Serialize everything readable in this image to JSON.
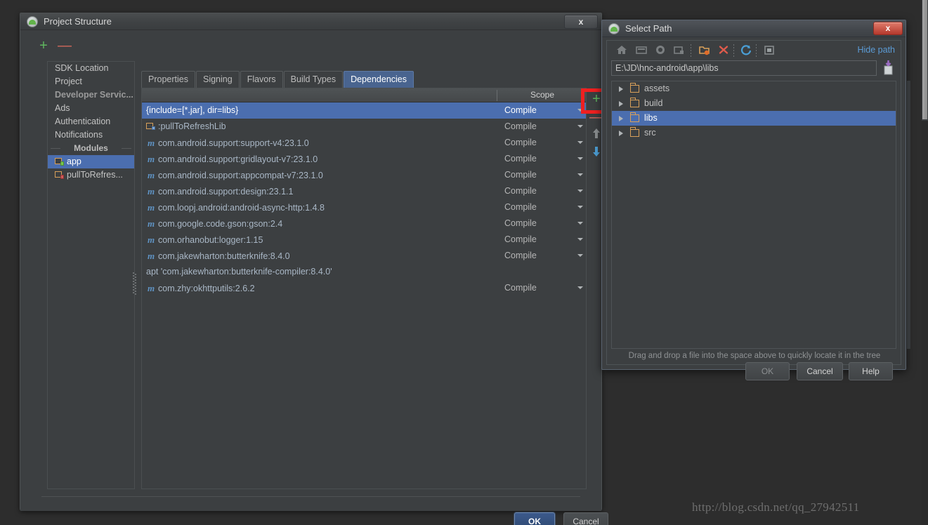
{
  "project_structure": {
    "title": "Project Structure",
    "window_icon": "android-studio-icon",
    "close_label": "x",
    "left_toolbar": {
      "add_label": "+",
      "remove_label": "—"
    },
    "sidebar": {
      "items": [
        {
          "label": "SDK Location",
          "type": "item"
        },
        {
          "label": "Project",
          "type": "item"
        },
        {
          "label": "Developer Servic...",
          "type": "group"
        },
        {
          "label": "Ads",
          "type": "item"
        },
        {
          "label": "Authentication",
          "type": "item"
        },
        {
          "label": "Notifications",
          "type": "item"
        },
        {
          "label": "Modules",
          "type": "separator"
        },
        {
          "label": "app",
          "type": "module",
          "icon": "module-app-icon",
          "selected": true
        },
        {
          "label": "pullToRefres...",
          "type": "module",
          "icon": "module-library-icon",
          "selected": false
        }
      ]
    },
    "tabs": [
      {
        "label": "Properties",
        "active": false
      },
      {
        "label": "Signing",
        "active": false
      },
      {
        "label": "Flavors",
        "active": false
      },
      {
        "label": "Build Types",
        "active": false
      },
      {
        "label": "Dependencies",
        "active": true
      }
    ],
    "dependencies": {
      "columns": {
        "name": "",
        "scope": "Scope"
      },
      "rows": [
        {
          "name": "{include=[*.jar], dir=libs}",
          "scope": "Compile",
          "icon": "none",
          "selected": true
        },
        {
          "name": ":pullToRefreshLib",
          "scope": "Compile",
          "icon": "module-folder-icon",
          "selected": false
        },
        {
          "name": "com.android.support:support-v4:23.1.0",
          "scope": "Compile",
          "icon": "maven-icon",
          "selected": false
        },
        {
          "name": "com.android.support:gridlayout-v7:23.1.0",
          "scope": "Compile",
          "icon": "maven-icon",
          "selected": false
        },
        {
          "name": "com.android.support:appcompat-v7:23.1.0",
          "scope": "Compile",
          "icon": "maven-icon",
          "selected": false
        },
        {
          "name": "com.android.support:design:23.1.1",
          "scope": "Compile",
          "icon": "maven-icon",
          "selected": false
        },
        {
          "name": "com.loopj.android:android-async-http:1.4.8",
          "scope": "Compile",
          "icon": "maven-icon",
          "selected": false
        },
        {
          "name": "com.google.code.gson:gson:2.4",
          "scope": "Compile",
          "icon": "maven-icon",
          "selected": false
        },
        {
          "name": "com.orhanobut:logger:1.15",
          "scope": "Compile",
          "icon": "maven-icon",
          "selected": false
        },
        {
          "name": "com.jakewharton:butterknife:8.4.0",
          "scope": "Compile",
          "icon": "maven-icon",
          "selected": false
        },
        {
          "name": "apt 'com.jakewharton:butterknife-compiler:8.4.0'",
          "scope": "",
          "icon": "none",
          "selected": false
        },
        {
          "name": "com.zhy:okhttputils:2.6.2",
          "scope": "Compile",
          "icon": "maven-icon",
          "selected": false
        }
      ],
      "side_toolbar": {
        "add_label": "+",
        "remove_label": "—",
        "move_up": "move-up-arrow-icon",
        "move_down": "move-down-arrow-icon",
        "highlight_color": "#ef2020"
      }
    },
    "footer": {
      "ok_label": "OK",
      "cancel_label": "Cancel"
    }
  },
  "select_path": {
    "title": "Select Path",
    "window_icon": "android-studio-icon",
    "close_label": "x",
    "toolbar_icons": [
      "home-icon",
      "desktop-icon",
      "project-icon",
      "folder-icon",
      "new-folder-icon",
      "delete-icon",
      "refresh-icon",
      "show-hidden-icon"
    ],
    "hide_path_label": "Hide path",
    "path_value": "E:\\JD\\hnc-android\\app\\libs",
    "paste_icon": "paste-icon",
    "tree": [
      {
        "label": "assets",
        "selected": false
      },
      {
        "label": "build",
        "selected": false
      },
      {
        "label": "libs",
        "selected": true
      },
      {
        "label": "src",
        "selected": false
      }
    ],
    "hint": "Drag and drop a file into the space above to quickly locate it in the tree",
    "buttons": {
      "ok_label": "OK",
      "cancel_label": "Cancel",
      "help_label": "Help"
    }
  },
  "watermark": {
    "text": "http://blog.csdn.net/qq_27942511"
  }
}
